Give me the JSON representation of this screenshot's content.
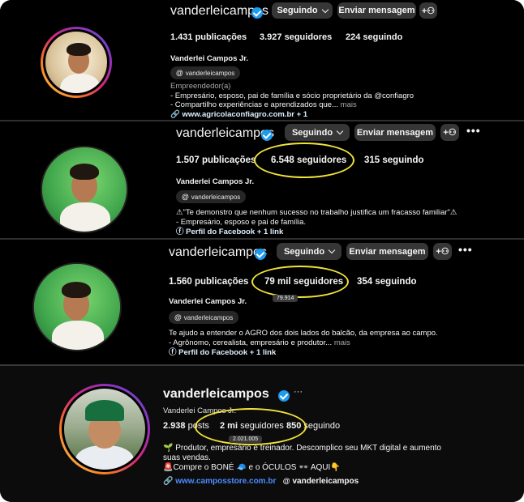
{
  "panels": [
    {
      "username": "vanderleicampos",
      "follow_btn": "Seguindo",
      "message_btn": "Enviar mensagem",
      "posts": "1.431 publicações",
      "followers": "3.927 seguidores",
      "following": "224 seguindo",
      "full_name": "Vanderlei Campos Jr.",
      "threads": "vanderleicampos",
      "category": "Empreendedor(a)",
      "bio_lines": [
        "- Empresário, esposo, pai de família e sócio proprietário da @confiagro",
        "- Compartilho experiências e aprendizados que..."
      ],
      "more": "mais",
      "link": "www.agricolaconfiagro.com.br + 1"
    },
    {
      "username": "vanderleicampos",
      "follow_btn": "Seguindo",
      "message_btn": "Enviar mensagem",
      "posts": "1.507 publicações",
      "followers": "6.548 seguidores",
      "following": "315 seguindo",
      "full_name": "Vanderlei Campos Jr.",
      "threads": "vanderleicampos",
      "bio_lines": [
        "⚠\"Te demonstro que nenhum sucesso no trabalho justifica um fracasso familiar\"⚠",
        "- Empresário, esposo e pai de família."
      ],
      "link": "Perfil do Facebook + 1 link"
    },
    {
      "username": "vanderleicampos",
      "follow_btn": "Seguindo",
      "message_btn": "Enviar mensagem",
      "posts": "1.560 publicações",
      "followers": "79 mil seguidores",
      "following": "354 seguindo",
      "full_name": "Vanderlei Campos Jr.",
      "tooltip": "79.914",
      "threads": "vanderleicampos",
      "bio_lines": [
        "Te ajudo a entender o AGRO dos dois lados do balcão, da empresa ao campo.",
        "- Agrônomo, cerealista, empresário e produtor..."
      ],
      "more": "mais",
      "link": "Perfil do Facebook + 1 link"
    },
    {
      "username": "vanderleicampos",
      "more_menu": "···",
      "full_name": "Vanderlei Campos Jr.",
      "posts_num": "2.938",
      "posts_label": "posts",
      "followers_num": "2 mi",
      "followers_label": "seguidores",
      "following_num": "850",
      "following_label": "seguindo",
      "tooltip": "2.021.005",
      "bio_lines": [
        "🌱 Produtor, empresário e treinador. Descomplico seu MKT digital e aumento",
        "suas vendas.",
        "🚨Compre o BONÉ 🧢 e o ÓCULOS 👓 AQUI👇"
      ],
      "link": "www.camposstore.com.br",
      "threads": "vanderleicampos"
    }
  ],
  "colors": {
    "highlight": "#f1e33a",
    "verified": "#1d9bf0",
    "button": "#363636",
    "link_blue": "#4d8cff"
  }
}
